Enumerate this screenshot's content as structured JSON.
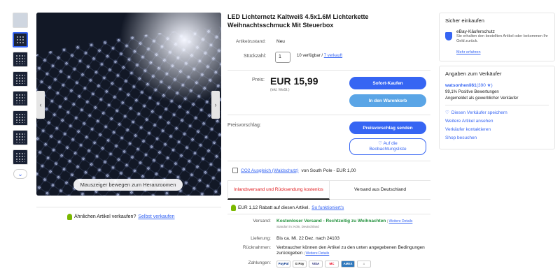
{
  "product": {
    "title": "LED Lichternetz Kaltweiß 4.5x1.6M Lichterkette Weihnachtsschmuck Mit Steuerbox",
    "condition_label": "Artikelzustand:",
    "condition_value": "Neu",
    "quantity_label": "Stückzahl:",
    "quantity_value": "1",
    "available_text": "10 verfügbar /",
    "sold_link": "7 verkauft",
    "price_label": "Preis:",
    "price": "EUR 15,99",
    "price_sub": "(inkl. MwSt.)",
    "offer_label": "Preisvorschlag:"
  },
  "buttons": {
    "buy_now": "Sofort-Kaufen",
    "add_to_cart": "In den Warenkorb",
    "send_offer": "Preisvorschlag senden",
    "watchlist_line1": "♡ Auf die",
    "watchlist_line2": "Beobachtungsliste"
  },
  "image": {
    "zoom_hint": "Mauszeiger bewegen zum Heranzoomen"
  },
  "sell": {
    "text": "Ähnlichen Artikel verkaufen?",
    "link": "Selbst verkaufen"
  },
  "co2": {
    "link": "CO2 Ausgleich (Waldschutz)",
    "text": "von South Pole - EUR 1,00"
  },
  "shipping_tabs": [
    {
      "label": "Inlandsversand und Rücksendung kostenlos"
    },
    {
      "label": "Versand aus Deutschland"
    }
  ],
  "rebate": {
    "text": "EUR 1,12 Rabatt auf diesen Artikel.",
    "link": "So funktioniert's"
  },
  "details": {
    "shipping_label": "Versand:",
    "shipping_value": "Kostenloser Versand - Rechtzeitig zu Weihnachten",
    "shipping_link": "Weitere Details",
    "shipping_sub": "Standort in: Köln, Deutschland",
    "delivery_label": "Lieferung:",
    "delivery_value": "Bis ca. Mi. 22 Dez. nach 24103",
    "returns_label": "Rücknahmen:",
    "returns_value": "Verbraucher können den Artikel zu den unten angegebenen Bedingungen zurückgeben",
    "returns_link": "Weitere Details",
    "payments_label": "Zahlungen:",
    "payments": [
      "PayPal",
      "G Pay",
      "VISA",
      "MC",
      "AMEX",
      "⌂"
    ]
  },
  "buyer_protection": {
    "title": "Sicher einkaufen",
    "name": "eBay-Käuferschutz",
    "desc": "Sie erhalten den bestellten Artikel oder bekommen Ihr Geld zurück.",
    "link": "Mehr erfahren"
  },
  "seller": {
    "title": "Angaben zum Verkäufer",
    "name": "watsonhenli61",
    "count": "(390 ★)",
    "positive": "99,1% Positive Bewertungen",
    "member": "Angemeldet als gewerblicher Verkäufer",
    "save": "Diesen Verkäufer speichern",
    "more": "Weitere Artikel ansehen",
    "contact": "Verkäufer kontaktieren",
    "shop": "Shop besuchen"
  }
}
